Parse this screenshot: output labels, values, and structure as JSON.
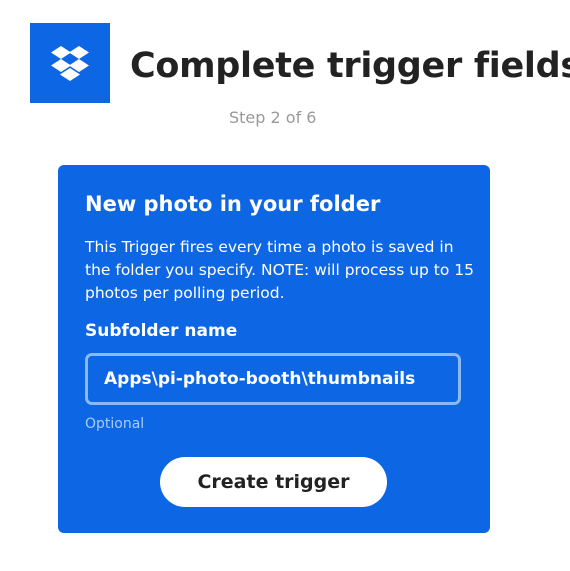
{
  "header": {
    "logo_icon": "dropbox-icon",
    "title": "Complete trigger fields",
    "step": "Step 2 of 6"
  },
  "card": {
    "title": "New photo in your folder",
    "description": "This Trigger fires every time a photo is saved in the folder you specify. NOTE: will process up to 15 photos per polling period.",
    "field": {
      "label": "Subfolder name",
      "value": "Apps\\pi-photo-booth\\thumbnails",
      "hint": "Optional"
    },
    "button_label": "Create trigger"
  },
  "colors": {
    "brand_blue": "#0d66e3",
    "title_text": "#222222",
    "muted_text": "#999999",
    "input_border": "#8ab9f7",
    "hint_text": "#a9ccf8"
  }
}
